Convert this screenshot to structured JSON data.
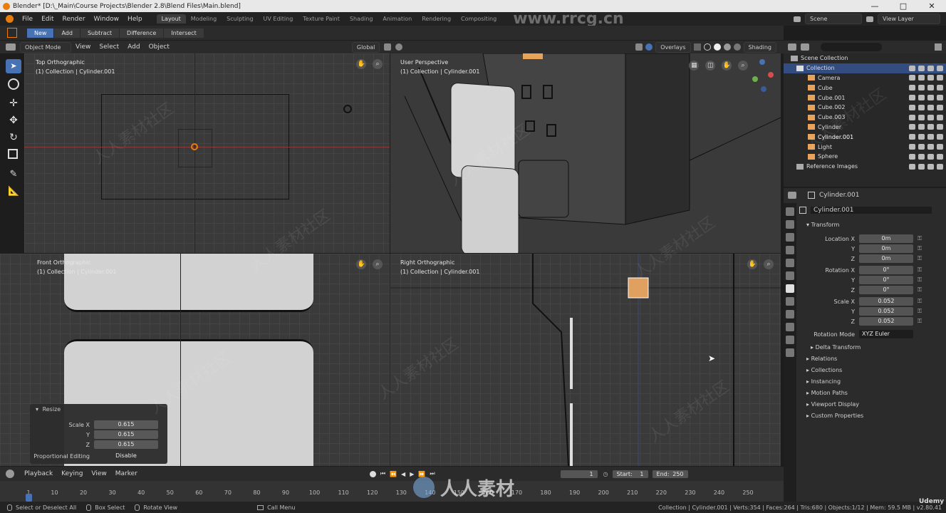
{
  "title_bar": {
    "text": "Blender* [D:\\_Main\\Course Projects\\Blender 2.8\\Blend Files\\Main.blend]",
    "minimize": "—",
    "maximize": "□",
    "close": "✕"
  },
  "menu": [
    "File",
    "Edit",
    "Render",
    "Window",
    "Help"
  ],
  "workspaces": [
    "Layout",
    "Modeling",
    "Sculpting",
    "UV Editing",
    "Texture Paint",
    "Shading",
    "Animation",
    "Rendering",
    "Compositing"
  ],
  "scene": {
    "label": "Scene",
    "view_layer": "View Layer"
  },
  "watermark": {
    "site": "www.rrcg.cn",
    "bottom": "人人素材",
    "tiles": "人人素材社区",
    "udemy": "Udemy"
  },
  "tool_header": {
    "modes": [
      "New",
      "Add",
      "Subtract",
      "Difference",
      "Intersect"
    ]
  },
  "viewport_header": {
    "mode": "Object Mode",
    "menus": [
      "View",
      "Select",
      "Add",
      "Object"
    ],
    "orientation": "Global",
    "overlays": "Overlays",
    "shading": "Shading"
  },
  "viewports": {
    "top": {
      "name": "Top Orthographic",
      "sub": "(1) Collection | Cylinder.001"
    },
    "persp": {
      "name": "User Perspective",
      "sub": "(1) Collection | Cylinder.001"
    },
    "front": {
      "name": "Front Orthographic",
      "sub": "(1) Collection | Cylinder.001"
    },
    "right": {
      "name": "Right Orthographic",
      "sub": "(1) Collection | Cylinder.001"
    }
  },
  "outliner": {
    "scene_collection": "Scene Collection",
    "collection": "Collection",
    "items": [
      "Camera",
      "Cube",
      "Cube.001",
      "Cube.002",
      "Cube.003",
      "Cylinder",
      "Cylinder.001",
      "Light",
      "Sphere"
    ],
    "reference": "Reference Images"
  },
  "properties": {
    "object_name": "Cylinder.001",
    "data_name": "Cylinder.001",
    "transform": "Transform",
    "location_label": "Location X",
    "location": [
      "0m",
      "0m",
      "0m"
    ],
    "rotation_label": "Rotation X",
    "rotation": [
      "0°",
      "0°",
      "0°"
    ],
    "scale_label": "Scale X",
    "scale": [
      "0.052",
      "0.052",
      "0.052"
    ],
    "axis_y": "Y",
    "axis_z": "Z",
    "rotation_mode_label": "Rotation Mode",
    "rotation_mode": "XYZ Euler",
    "delta": "Delta Transform",
    "sections": [
      "Relations",
      "Collections",
      "Instancing",
      "Motion Paths",
      "Viewport Display",
      "Custom Properties"
    ]
  },
  "resize_panel": {
    "title": "Resize",
    "scale_x_label": "Scale X",
    "y_label": "Y",
    "z_label": "Z",
    "values": [
      "0.615",
      "0.615",
      "0.615"
    ],
    "prop_edit_label": "Proportional Editing",
    "prop_edit_value": "Disable"
  },
  "timeline": {
    "menus": [
      "Playback",
      "Keying",
      "View",
      "Marker"
    ],
    "current_frame": "1",
    "start_label": "Start:",
    "start": "1",
    "end_label": "End:",
    "end": "250",
    "ticks": [
      "1",
      "10",
      "20",
      "30",
      "40",
      "50",
      "60",
      "70",
      "80",
      "90",
      "100",
      "110",
      "120",
      "130",
      "140",
      "150",
      "160",
      "170",
      "180",
      "190",
      "200",
      "210",
      "220",
      "230",
      "240",
      "250"
    ]
  },
  "status_bar": {
    "left": [
      "Select or Deselect All",
      "Box Select",
      "Rotate View",
      "Call Menu"
    ],
    "right": "Collection | Cylinder.001 | Verts:354 | Faces:264 | Tris:680 | Objects:1/12 | Mem: 59.5 MB | v2.80.41"
  }
}
